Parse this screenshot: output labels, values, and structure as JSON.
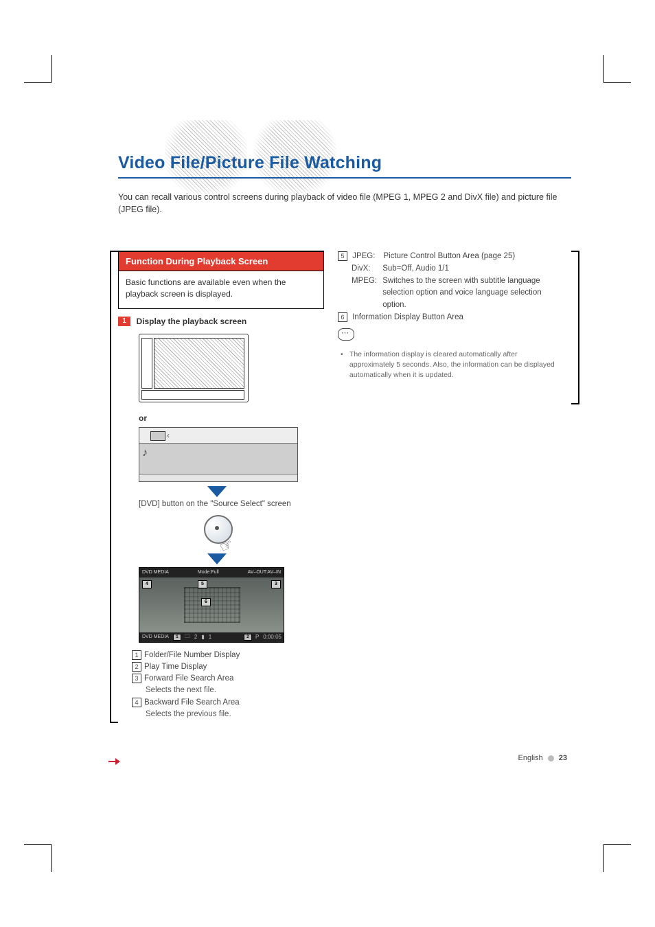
{
  "title": "Video File/Picture File Watching",
  "intro": "You can recall various control screens during playback of video file (MPEG 1, MPEG 2 and DivX file) and picture file (JPEG file).",
  "section": {
    "heading": "Function During Playback Screen",
    "body": "Basic functions are available even when the playback screen is displayed.",
    "step_num": "1",
    "step_label": "Display the playback screen"
  },
  "or_label": "or",
  "source_caption": "[DVD] button on the \"Source Select\" screen",
  "dvd_screen": {
    "top_left": "DVD MEDIA",
    "top_mid": "Mode:Full",
    "top_right": "AV–OUT:AV–IN",
    "bot_left": "DVD MEDIA",
    "folder_icon": "2",
    "file_icon": "1",
    "play": "P",
    "time": "0:00:05",
    "box3": "3",
    "box4": "4",
    "box5": "5",
    "box6": "6",
    "box1": "1",
    "box2": "2"
  },
  "legend": {
    "i1_num": "1",
    "i1": "Folder/File Number Display",
    "i2_num": "2",
    "i2": "Play Time Display",
    "i3_num": "3",
    "i3": "Forward File Search Area",
    "i3_sub": "Selects the next file.",
    "i4_num": "4",
    "i4": "Backward File Search Area",
    "i4_sub": "Selects the previous file."
  },
  "right": {
    "i5_num": "5",
    "i5_jpeg_lbl": "JPEG:",
    "i5_jpeg": "Picture Control Button Area (page 25)",
    "i5_divx_lbl": "DivX:",
    "i5_divx": "Sub=Off, Audio 1/1",
    "i5_mpeg_lbl": "MPEG:",
    "i5_mpeg": "Switches to the screen with subtitle language selection option and voice language selection option.",
    "i6_num": "6",
    "i6": "Information Display Button Area",
    "note": "The information display is cleared automatically after approximately 5 seconds. Also, the information can be displayed automatically when it is updated."
  },
  "footer": {
    "lang": "English",
    "page": "23"
  }
}
